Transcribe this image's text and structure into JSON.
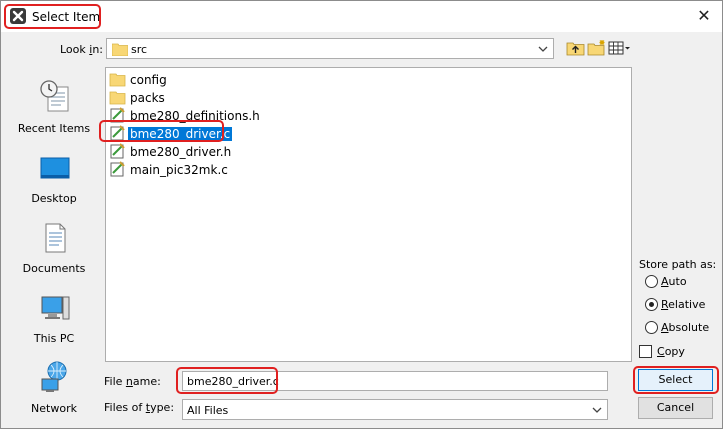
{
  "window": {
    "title": "Select Item",
    "close_glyph": "✕",
    "app_icon": "app-icon"
  },
  "look_in": {
    "label": "Look in:",
    "label_prefix": "Look ",
    "label_underlined": "i",
    "label_suffix": "n:",
    "value": "src"
  },
  "toolbar": {
    "icons": [
      "up-folder-icon",
      "new-folder-icon",
      "view-menu-icon"
    ]
  },
  "places": [
    {
      "label": "Recent Items",
      "icon": "recent-items-icon"
    },
    {
      "label": "Desktop",
      "icon": "desktop-icon"
    },
    {
      "label": "Documents",
      "icon": "documents-icon"
    },
    {
      "label": "This PC",
      "icon": "this-pc-icon"
    },
    {
      "label": "Network",
      "icon": "network-icon"
    }
  ],
  "files": [
    {
      "name": "config",
      "type": "folder",
      "selected": false
    },
    {
      "name": "packs",
      "type": "folder",
      "selected": false
    },
    {
      "name": "bme280_definitions.h",
      "type": "file",
      "selected": false
    },
    {
      "name": "bme280_driver.c",
      "type": "file",
      "selected": true
    },
    {
      "name": "bme280_driver.h",
      "type": "file",
      "selected": false
    },
    {
      "name": "main_pic32mk.c",
      "type": "file",
      "selected": false
    }
  ],
  "file_name": {
    "label_prefix": "File ",
    "label_underlined": "n",
    "label_suffix": "ame:",
    "value": "bme280_driver.c"
  },
  "files_of_type": {
    "label_prefix": "Files of ",
    "label_underlined": "t",
    "label_suffix": "ype:",
    "value": "All Files"
  },
  "store_path": {
    "label": "Store path as:",
    "options": [
      {
        "label_underlined": "A",
        "label_rest": "uto",
        "checked": false
      },
      {
        "label_underlined": "R",
        "label_rest": "elative",
        "checked": true
      },
      {
        "label_underlined": "A",
        "label_rest": "bsolute",
        "checked": false
      }
    ]
  },
  "copy": {
    "label_underlined": "C",
    "label_rest": "opy",
    "checked": false
  },
  "buttons": {
    "select": "Select",
    "cancel": "Cancel"
  },
  "colors": {
    "selection": "#0078d7",
    "highlight": "#e02020",
    "folder": "#f8d775"
  }
}
